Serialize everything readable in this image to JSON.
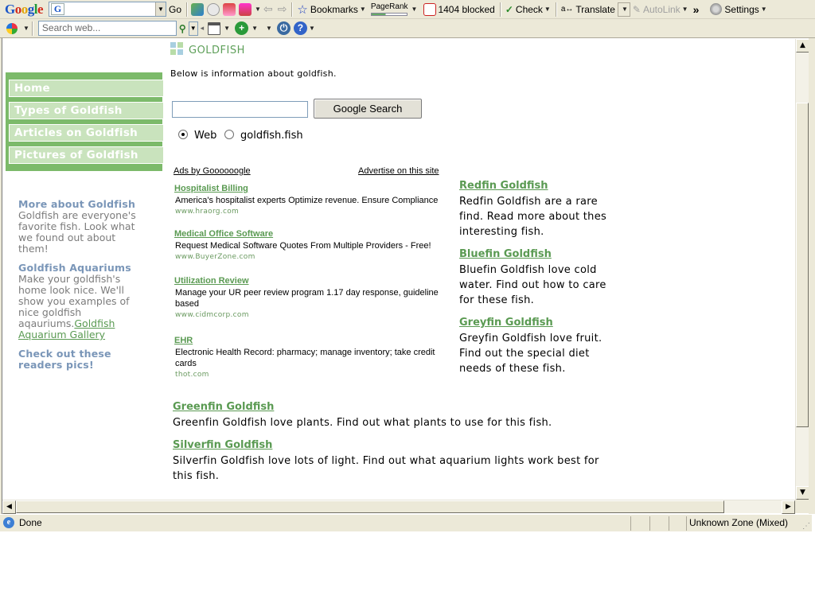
{
  "toolbar1": {
    "go_label": "Go",
    "bookmarks_label": "Bookmarks",
    "pagerank_label": "PageRank",
    "blocked_label": "1404 blocked",
    "check_label": "Check",
    "translate_label": "Translate",
    "autolink_label": "AutoLink",
    "more_label": "»",
    "settings_label": "Settings"
  },
  "toolbar2": {
    "search_placeholder": "Search web..."
  },
  "page": {
    "header_title": "GOLDFISH",
    "intro": "Below is information about goldfish.",
    "nav": [
      "Home",
      "Types of Goldfish",
      "Articles on Goldfish",
      "Pictures of Goldfish"
    ],
    "sidebar": {
      "more_title": "More about Goldfish",
      "more_text": "Goldfish are everyone's favorite fish. Look what we found out about them!",
      "aquariums_title": "Goldfish Aquariums",
      "aquariums_text": "Make your goldfish's home look nice. We'll show you examples of nice goldfish aqauriums.",
      "gallery_link": "Goldfish Aquarium Gallery",
      "readers_link": "Check out these readers pics!"
    },
    "search": {
      "button_label": "Google Search",
      "radio_web": "Web",
      "radio_site": "goldfish.fish",
      "selected": "Web"
    },
    "ads": {
      "ads_by": "Ads by Goooooogle",
      "advertise": "Advertise on this site",
      "items": [
        {
          "title": "Hospitalist Billing",
          "desc": "America's hospitalist experts Optimize revenue. Ensure Compliance",
          "url": "www.hraorg.com"
        },
        {
          "title": "Medical Office Software",
          "desc": "Request Medical Software Quotes From Multiple Providers - Free!",
          "url": "www.BuyerZone.com"
        },
        {
          "title": "Utilization Review",
          "desc": "Manage your UR peer review program 1.17 day response, guideline based",
          "url": "www.cidmcorp.com"
        },
        {
          "title": "EHR",
          "desc": "Electronic Health Record: pharmacy; manage inventory; take credit cards",
          "url": "thot.com"
        }
      ]
    },
    "articles": [
      {
        "title": "Redfin Goldfish",
        "desc": "Redfin Goldfish are a rare find. Read more about thes interesting fish."
      },
      {
        "title": "Bluefin Goldfish",
        "desc": "Bluefin Goldfish love cold water. Find out how to care for these fish."
      },
      {
        "title": "Greyfin Goldfish",
        "desc": "Greyfin Goldfish love fruit. Find out the special diet needs of these fish."
      },
      {
        "title": "Greenfin Goldfish",
        "desc": "Greenfin Goldfish love plants. Find out what plants to use for this fish."
      },
      {
        "title": "Silverfin Goldfish",
        "desc": "Silverfin Goldfish love lots of light. Find out what aquarium lights work best for this fish."
      }
    ]
  },
  "statusbar": {
    "status": "Done",
    "zone": "Unknown Zone (Mixed)"
  },
  "colors": {
    "nav_green": "#7cba6a",
    "nav_item": "#c9e3bd",
    "link_green": "#5a9a52",
    "side_heading_blue": "#7a96b8",
    "chrome": "#ece9d8"
  }
}
